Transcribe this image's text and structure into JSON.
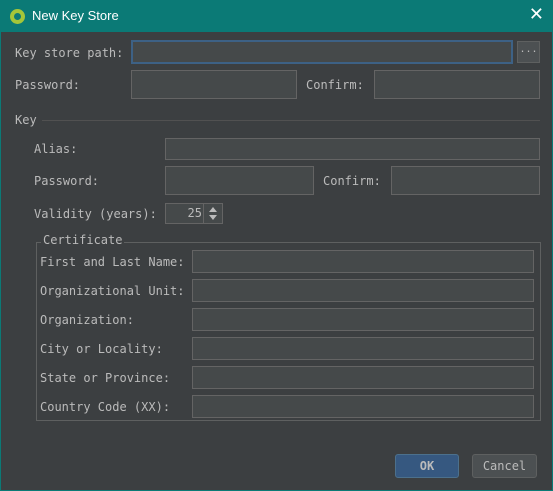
{
  "window": {
    "title": "New Key Store"
  },
  "keystore": {
    "path_label": "Key store path:",
    "path_value": "",
    "browse_label": "...",
    "password_label": "Password:",
    "confirm_label": "Confirm:"
  },
  "key": {
    "section_label": "Key",
    "alias_label": "Alias:",
    "password_label": "Password:",
    "confirm_label": "Confirm:",
    "validity_label": "Validity (years):",
    "validity_value": "25"
  },
  "certificate": {
    "group_title": "Certificate",
    "fields": [
      {
        "label": "First and Last Name:"
      },
      {
        "label": "Organizational Unit:"
      },
      {
        "label": "Organization:"
      },
      {
        "label": "City or Locality:"
      },
      {
        "label": "State or Province:"
      },
      {
        "label": "Country Code (XX):"
      }
    ]
  },
  "buttons": {
    "ok": "OK",
    "cancel": "Cancel"
  }
}
